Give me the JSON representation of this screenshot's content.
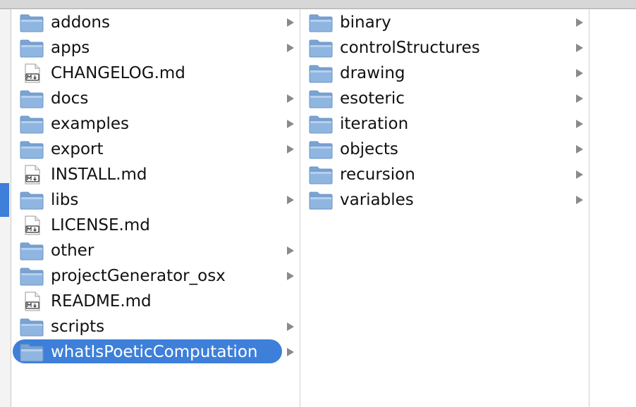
{
  "columns": [
    {
      "items": [
        {
          "label": "addons",
          "type": "folder",
          "has_children": true,
          "selected": false
        },
        {
          "label": "apps",
          "type": "folder",
          "has_children": true,
          "selected": false
        },
        {
          "label": "CHANGELOG.md",
          "type": "markdown",
          "has_children": false,
          "selected": false
        },
        {
          "label": "docs",
          "type": "folder",
          "has_children": true,
          "selected": false
        },
        {
          "label": "examples",
          "type": "folder",
          "has_children": true,
          "selected": false
        },
        {
          "label": "export",
          "type": "folder",
          "has_children": true,
          "selected": false
        },
        {
          "label": "INSTALL.md",
          "type": "markdown",
          "has_children": false,
          "selected": false
        },
        {
          "label": "libs",
          "type": "folder",
          "has_children": true,
          "selected": false
        },
        {
          "label": "LICENSE.md",
          "type": "markdown",
          "has_children": false,
          "selected": false
        },
        {
          "label": "other",
          "type": "folder",
          "has_children": true,
          "selected": false
        },
        {
          "label": "projectGenerator_osx",
          "type": "folder",
          "has_children": true,
          "selected": false
        },
        {
          "label": "README.md",
          "type": "markdown",
          "has_children": false,
          "selected": false
        },
        {
          "label": "scripts",
          "type": "folder",
          "has_children": true,
          "selected": false
        },
        {
          "label": "whatIsPoeticComputation",
          "type": "folder",
          "has_children": true,
          "selected": true
        }
      ]
    },
    {
      "items": [
        {
          "label": "binary",
          "type": "folder",
          "has_children": true,
          "selected": false
        },
        {
          "label": "controlStructures",
          "type": "folder",
          "has_children": true,
          "selected": false
        },
        {
          "label": "drawing",
          "type": "folder",
          "has_children": true,
          "selected": false
        },
        {
          "label": "esoteric",
          "type": "folder",
          "has_children": true,
          "selected": false
        },
        {
          "label": "iteration",
          "type": "folder",
          "has_children": true,
          "selected": false
        },
        {
          "label": "objects",
          "type": "folder",
          "has_children": true,
          "selected": false
        },
        {
          "label": "recursion",
          "type": "folder",
          "has_children": true,
          "selected": false
        },
        {
          "label": "variables",
          "type": "folder",
          "has_children": true,
          "selected": false
        }
      ]
    },
    {
      "items": []
    }
  ],
  "icons": {
    "folder": "folder-icon",
    "markdown": "markdown-file-icon",
    "disclosure": "disclosure-arrow-icon"
  },
  "colors": {
    "selection": "#3d7fd9",
    "folder_body": "#8fb6e0",
    "folder_tab": "#7aa4d4",
    "arrow": "#8a8a8a"
  }
}
